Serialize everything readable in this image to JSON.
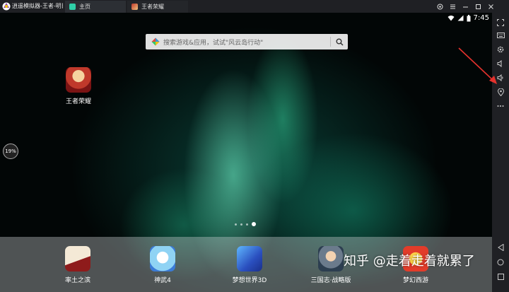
{
  "window": {
    "title": "逍遥模拟器-王者-明日",
    "tabs": [
      {
        "label": "主页",
        "active": true
      },
      {
        "label": "王者荣耀",
        "active": false
      }
    ],
    "controls": [
      "pin-icon",
      "menu-icon",
      "minimize-icon",
      "maximize-icon",
      "close-icon"
    ]
  },
  "statusbar": {
    "time": "7:45"
  },
  "search": {
    "placeholder": "搜索游戏&应用，试试\"风云岛行动\""
  },
  "desktop": {
    "apps": [
      {
        "label": "王者荣耀"
      }
    ]
  },
  "progress_badge": "19%",
  "pager": {
    "pages": 4,
    "active": 4
  },
  "dock": {
    "apps": [
      {
        "label": "率土之滨"
      },
      {
        "label": "神武4"
      },
      {
        "label": "梦想世界3D"
      },
      {
        "label": "三国志·战略版"
      },
      {
        "label": "梦幻西游"
      }
    ]
  },
  "watermark": "知乎 @走着走着就累了",
  "right_toolbar": [
    "fullscreen-icon",
    "keyboard-icon",
    "settings-icon",
    "volume-down-icon",
    "volume-up-icon",
    "location-icon",
    "more-icon",
    "back-icon",
    "home-icon",
    "recents-icon"
  ],
  "colors": {
    "accent": "#2fd0a8",
    "arrow": "#e5322d",
    "bar": "#1f2024"
  }
}
